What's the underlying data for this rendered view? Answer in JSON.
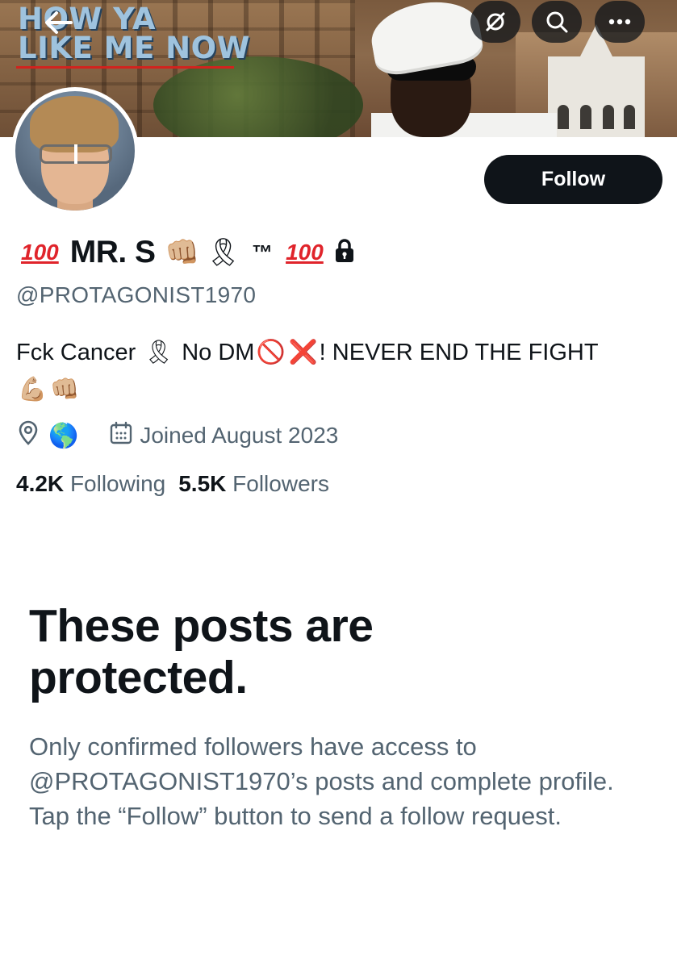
{
  "banner": {
    "album_title_line1": "HOW YA",
    "album_title_line2": "LIKE ME NOW"
  },
  "profile": {
    "display_name": "MR. S",
    "name_badges": {
      "hundred_left": "100",
      "fist": "👊🏼",
      "ribbon": "🎗",
      "tm": "™",
      "hundred_right": "100"
    },
    "handle": "@PROTAGONIST1970",
    "bio_part1": "Fck Cancer ",
    "bio_ribbon": "🎗",
    "bio_part2": " No DM",
    "bio_no_entry": "🚫",
    "bio_cross": "❌",
    "bio_part3": "! NEVER END THE FIGHT ",
    "bio_muscle": "💪🏼",
    "bio_fist": "👊🏼",
    "location_emoji": "🌎",
    "joined": "Joined August 2023",
    "following_count": "4.2K",
    "following_label": "Following",
    "followers_count": "5.5K",
    "followers_label": "Followers"
  },
  "actions": {
    "follow_label": "Follow"
  },
  "protected": {
    "title": "These posts are protected.",
    "body": "Only confirmed followers have access to @PROTAGONIST1970’s posts and complete profile. Tap the “Follow” button to send a follow request."
  },
  "colors": {
    "text_primary": "#0f1419",
    "text_secondary": "#536471",
    "button_dark": "#0f1419",
    "accent_red": "#e0242b"
  },
  "icons": [
    "back-arrow-icon",
    "translate-off-icon",
    "search-icon",
    "more-icon",
    "lock-icon",
    "location-pin-icon",
    "calendar-icon"
  ]
}
